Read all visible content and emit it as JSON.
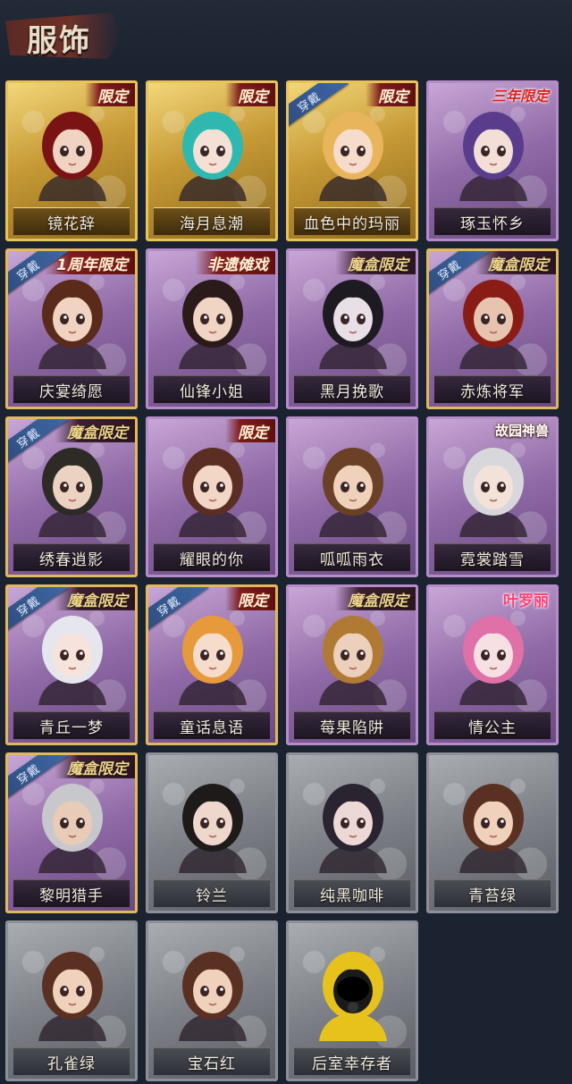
{
  "header": {
    "title": "服饰"
  },
  "wear_label": "穿戴",
  "colors": {
    "background": "#1b2230",
    "gold_card": "#e8c25a",
    "purple_card": "#b68cc8",
    "gray_card": "#8d9096",
    "wear_ribbon": "#3d66a5"
  },
  "costumes": [
    {
      "name": "镜花辞",
      "tier": "gold",
      "badge": "限定",
      "badge_style": "red-ribbon",
      "equipped": false,
      "hair": "#7a1414",
      "skin": "#f1d3c2"
    },
    {
      "name": "海月息潮",
      "tier": "gold",
      "badge": "限定",
      "badge_style": "red-ribbon",
      "equipped": false,
      "hair": "#2fb8b0",
      "skin": "#f4e0d4"
    },
    {
      "name": "血色中的玛丽",
      "tier": "gold",
      "badge": "限定",
      "badge_style": "red-ribbon",
      "equipped": true,
      "hair": "#e8b55c",
      "skin": "#f6dccb"
    },
    {
      "name": "琢玉怀乡",
      "tier": "purple",
      "badge": "三年限定",
      "badge_style": "red-text",
      "equipped": false,
      "hair": "#5a3c8c",
      "skin": "#f3dfd8"
    },
    {
      "name": "庆宴绮愿",
      "tier": "purple",
      "badge": "1周年限定",
      "badge_style": "red-ribbon",
      "equipped": true,
      "hair": "#5a2a1a",
      "skin": "#f1d3c2"
    },
    {
      "name": "仙锋小姐",
      "tier": "purple",
      "badge": "非遗傩戏",
      "badge_style": "red-ribbon",
      "equipped": false,
      "hair": "#2a1a1a",
      "skin": "#f0d4c4"
    },
    {
      "name": "黑月挽歌",
      "tier": "purple",
      "badge": "魔盒限定",
      "badge_style": "dark",
      "equipped": false,
      "hair": "#1e1a22",
      "skin": "#e8e0e6"
    },
    {
      "name": "赤炼将军",
      "tier": "purple",
      "badge": "魔盒限定",
      "badge_style": "dark",
      "equipped": true,
      "hair": "#8a1c16",
      "skin": "#e6c4b0"
    },
    {
      "name": "绣春逍影",
      "tier": "purple",
      "badge": "魔盒限定",
      "badge_style": "dark",
      "equipped": true,
      "hair": "#2e2a26",
      "skin": "#ecd2c0"
    },
    {
      "name": "耀眼的你",
      "tier": "purple",
      "badge": "限定",
      "badge_style": "red-ribbon",
      "equipped": false,
      "hair": "#5a2e22",
      "skin": "#f2d6c6"
    },
    {
      "name": "呱呱雨衣",
      "tier": "purple",
      "badge": "",
      "badge_style": "none",
      "equipped": false,
      "hair": "#6a4026",
      "skin": "#f0d2bc"
    },
    {
      "name": "霓裳踏雪",
      "tier": "purple",
      "badge": "故园神兽",
      "badge_style": "white",
      "equipped": false,
      "hair": "#d8d8dc",
      "skin": "#f2e2da"
    },
    {
      "name": "青丘一梦",
      "tier": "purple",
      "badge": "魔盒限定",
      "badge_style": "dark",
      "equipped": true,
      "hair": "#e6e6ee",
      "skin": "#f6e4dc"
    },
    {
      "name": "童话息语",
      "tier": "purple",
      "badge": "限定",
      "badge_style": "red-ribbon",
      "equipped": true,
      "hair": "#e69a3c",
      "skin": "#f6dccb"
    },
    {
      "name": "莓果陷阱",
      "tier": "purple",
      "badge": "魔盒限定",
      "badge_style": "dark",
      "equipped": false,
      "hair": "#b07a34",
      "skin": "#ecd0bc"
    },
    {
      "name": "情公主",
      "tier": "purple",
      "badge": "叶罗丽",
      "badge_style": "pink",
      "equipped": false,
      "hair": "#e070a8",
      "skin": "#f6e0e4"
    },
    {
      "name": "黎明猎手",
      "tier": "purple",
      "badge": "魔盒限定",
      "badge_style": "dark",
      "equipped": true,
      "hair": "#c8c8cc",
      "skin": "#e8ccb8"
    },
    {
      "name": "铃兰",
      "tier": "gray",
      "badge": "",
      "badge_style": "none",
      "equipped": false,
      "hair": "#1e1a1a",
      "skin": "#eed8cc"
    },
    {
      "name": "纯黑咖啡",
      "tier": "gray",
      "badge": "",
      "badge_style": "none",
      "equipped": false,
      "hair": "#2a2430",
      "skin": "#ecd8d4"
    },
    {
      "name": "青苔绿",
      "tier": "gray",
      "badge": "",
      "badge_style": "none",
      "equipped": false,
      "hair": "#5a3022",
      "skin": "#f0d2bc"
    },
    {
      "name": "孔雀绿",
      "tier": "gray",
      "badge": "",
      "badge_style": "none",
      "equipped": false,
      "hair": "#5a3022",
      "skin": "#f0d2bc"
    },
    {
      "name": "宝石红",
      "tier": "gray",
      "badge": "",
      "badge_style": "none",
      "equipped": false,
      "hair": "#5a3022",
      "skin": "#f0d2bc"
    },
    {
      "name": "后室幸存者",
      "tier": "gray",
      "badge": "",
      "badge_style": "none",
      "equipped": false,
      "hair": "#e8c21c",
      "skin": "#1a1a1a"
    }
  ]
}
